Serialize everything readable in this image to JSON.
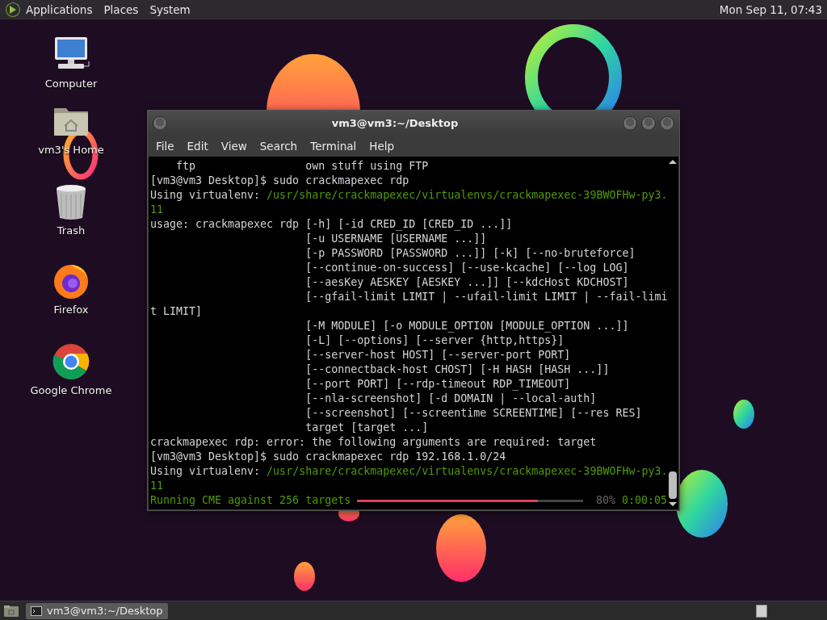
{
  "top_panel": {
    "menus": [
      "Applications",
      "Places",
      "System"
    ],
    "clock": "Mon Sep 11, 07:43"
  },
  "desktop_icons": [
    {
      "label": "Computer",
      "kind": "computer"
    },
    {
      "label": "vm3's Home",
      "kind": "home"
    },
    {
      "label": "Trash",
      "kind": "trash"
    },
    {
      "label": "Firefox",
      "kind": "firefox"
    },
    {
      "label": "Google Chrome",
      "kind": "chrome"
    }
  ],
  "terminal_window": {
    "title": "vm3@vm3:~/Desktop",
    "menu": [
      "File",
      "Edit",
      "View",
      "Search",
      "Terminal",
      "Help"
    ],
    "lines": [
      [
        {
          "kind": "plain",
          "text": "    ftp                 own stuff using FTP"
        }
      ],
      [
        {
          "kind": "plain",
          "text": "[vm3@vm3 Desktop]$ sudo crackmapexec rdp"
        }
      ],
      [
        {
          "kind": "plain",
          "text": "Using virtualenv: "
        },
        {
          "kind": "path",
          "text": "/usr/share/crackmapexec/virtualenvs/crackmapexec-39BWOFHw-py3."
        }
      ],
      [
        {
          "kind": "path",
          "text": "11"
        }
      ],
      [
        {
          "kind": "plain",
          "text": "usage: crackmapexec rdp [-h] [-id CRED_ID [CRED_ID ...]]"
        }
      ],
      [
        {
          "kind": "plain",
          "text": "                        [-u USERNAME [USERNAME ...]]"
        }
      ],
      [
        {
          "kind": "plain",
          "text": "                        [-p PASSWORD [PASSWORD ...]] [-k] [--no-bruteforce]"
        }
      ],
      [
        {
          "kind": "plain",
          "text": "                        [--continue-on-success] [--use-kcache] [--log LOG]"
        }
      ],
      [
        {
          "kind": "plain",
          "text": "                        [--aesKey AESKEY [AESKEY ...]] [--kdcHost KDCHOST]"
        }
      ],
      [
        {
          "kind": "plain",
          "text": "                        [--gfail-limit LIMIT | --ufail-limit LIMIT | --fail-limi"
        }
      ],
      [
        {
          "kind": "plain",
          "text": "t LIMIT]"
        }
      ],
      [
        {
          "kind": "plain",
          "text": "                        [-M MODULE] [-o MODULE_OPTION [MODULE_OPTION ...]]"
        }
      ],
      [
        {
          "kind": "plain",
          "text": "                        [-L] [--options] [--server {http,https}]"
        }
      ],
      [
        {
          "kind": "plain",
          "text": "                        [--server-host HOST] [--server-port PORT]"
        }
      ],
      [
        {
          "kind": "plain",
          "text": "                        [--connectback-host CHOST] [-H HASH [HASH ...]]"
        }
      ],
      [
        {
          "kind": "plain",
          "text": "                        [--port PORT] [--rdp-timeout RDP_TIMEOUT]"
        }
      ],
      [
        {
          "kind": "plain",
          "text": "                        [--nla-screenshot] [-d DOMAIN | --local-auth]"
        }
      ],
      [
        {
          "kind": "plain",
          "text": "                        [--screenshot] [--screentime SCREENTIME] [--res RES]"
        }
      ],
      [
        {
          "kind": "plain",
          "text": "                        target [target ...]"
        }
      ],
      [
        {
          "kind": "plain",
          "text": "crackmapexec rdp: error: the following arguments are required: target"
        }
      ],
      [
        {
          "kind": "plain",
          "text": "[vm3@vm3 Desktop]$ sudo crackmapexec rdp 192.168.1.0/24"
        }
      ],
      [
        {
          "kind": "plain",
          "text": "Using virtualenv: "
        },
        {
          "kind": "path",
          "text": "/usr/share/crackmapexec/virtualenvs/crackmapexec-39BWOFHw-py3."
        }
      ],
      [
        {
          "kind": "path",
          "text": "11"
        }
      ]
    ],
    "progress": {
      "label": "Running CME against 256 targets",
      "level": 0.8,
      "percent": "80%",
      "elapsed": "0:00:05"
    }
  },
  "taskbar": {
    "tasks": [
      {
        "label": "vm3@vm3:~/Desktop",
        "selected": true
      }
    ]
  }
}
